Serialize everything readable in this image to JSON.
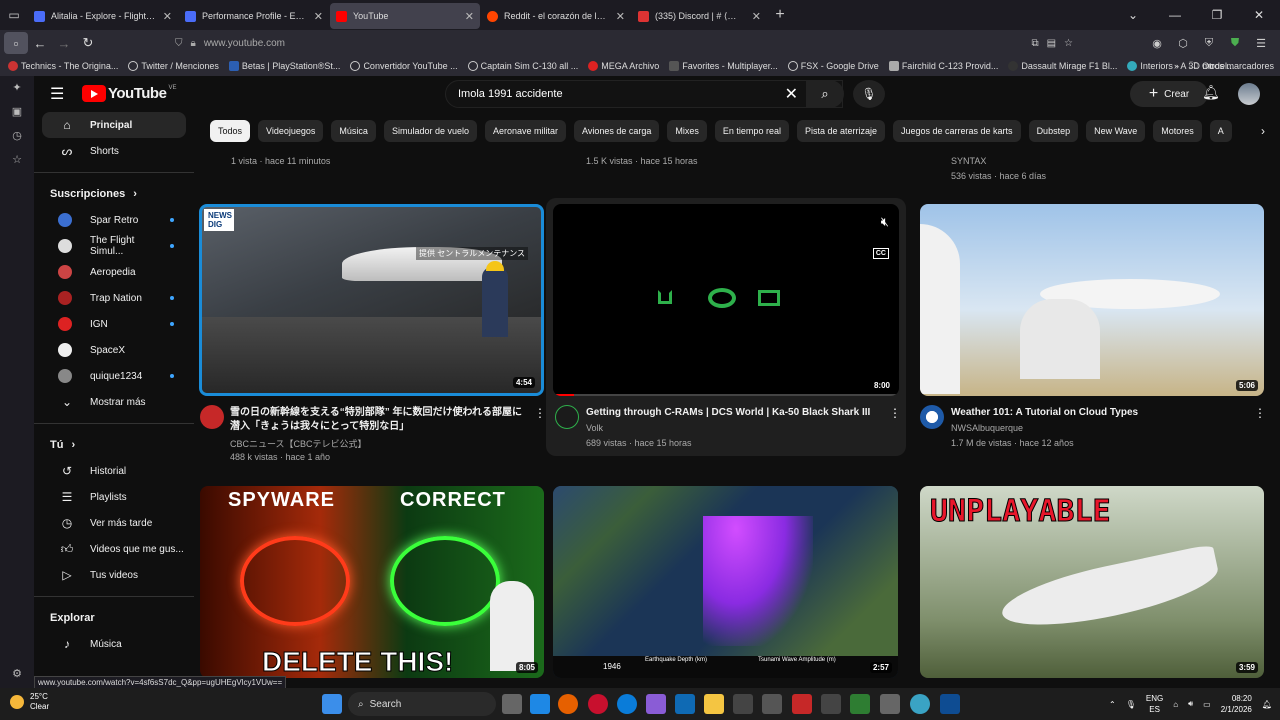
{
  "browser": {
    "tabs": [
      {
        "title": "Alitalia - Explore - Flightsim.to",
        "color": "#4a6cf7"
      },
      {
        "title": "Performance Profile - Explore - ",
        "color": "#4a6cf7"
      },
      {
        "title": "YouTube",
        "color": "#ff0000",
        "active": true
      },
      {
        "title": "Reddit - el corazón de la conve",
        "color": "#ff4500"
      },
      {
        "title": "(335) Discord | # ⟨💬⟩ [chart",
        "color": "#d33"
      }
    ],
    "url": "www.youtube.com",
    "bookmarks": [
      "Technics - The Origina...",
      "Twitter / Menciones",
      "Betas | PlayStation®St...",
      "Convertidor YouTube ...",
      "Captain Sim C-130 all ...",
      "MEGA Archivo",
      "Favorites - Multiplayer...",
      "FSX - Google Drive",
      "Fairchild C-123 Provid...",
      "Dassault Mirage F1 Bl...",
      "Interiors - A 3D model..."
    ],
    "bookmarks_other": "Otros marcadores"
  },
  "youtube": {
    "logo": "YouTube",
    "region": "VE",
    "search_query": "Imola 1991 accidente",
    "create_label": "Crear",
    "sidebar": {
      "main": [
        {
          "label": "Principal",
          "icon": "home-icon",
          "glyph": "⌂"
        },
        {
          "label": "Shorts",
          "icon": "shorts-icon",
          "glyph": "▶"
        }
      ],
      "subs_header": "Suscripciones",
      "subs": [
        {
          "label": "Spar Retro",
          "color": "#3b6fd1"
        },
        {
          "label": "The Flight Simul...",
          "color": "#e0e0e0"
        },
        {
          "label": "Aeropedia",
          "color": "#c44"
        },
        {
          "label": "Trap Nation",
          "color": "#c22"
        },
        {
          "label": "IGN",
          "color": "#d22"
        },
        {
          "label": "SpaceX",
          "color": "#eee"
        },
        {
          "label": "quique1234",
          "color": "#888"
        }
      ],
      "show_more": "Mostrar más",
      "you_header": "Tú",
      "you": [
        {
          "label": "Historial",
          "glyph": "↺"
        },
        {
          "label": "Playlists",
          "glyph": "☰"
        },
        {
          "label": "Ver más tarde",
          "glyph": "◷"
        },
        {
          "label": "Videos que me gus...",
          "glyph": "👍"
        },
        {
          "label": "Tus videos",
          "glyph": "▷"
        }
      ],
      "explore_header": "Explorar",
      "explore": [
        {
          "label": "Música",
          "glyph": "♪"
        }
      ]
    },
    "chips": [
      "Todos",
      "Videojuegos",
      "Música",
      "Simulador de vuelo",
      "Aeronave militar",
      "Aviones de carga",
      "Mixes",
      "En tiempo real",
      "Pista de aterrizaje",
      "Juegos de carreras de karts",
      "Dubstep",
      "New Wave",
      "Motores",
      "A"
    ],
    "top_meta": [
      "1 vista · hace 11 minutos",
      "1.5 K vistas · hace 15 horas",
      "SYNTAX",
      "536 vistas · hace 6 días"
    ],
    "videos": [
      {
        "title": "雪の日の新幹線を支える“特別部隊” 年に数回だけ使われる部屋に潜入「きょうは我々にとって特別な日」",
        "channel": "CBCニュース【CBCテレビ公式】",
        "meta": "488 k vistas · hace 1 año",
        "duration": "4:54",
        "badge": "NEWS DIG",
        "caption": "提供 セントラルメンテナンス"
      },
      {
        "title": "Getting through C-RAMs | DCS World | Ka-50 Black Shark III",
        "channel": "Volk",
        "meta": "689 vistas · hace 15 horas",
        "duration": "8:00",
        "cc": "CC"
      },
      {
        "title": "Weather 101: A Tutorial on Cloud Types",
        "channel": "NWSAlbuquerque",
        "meta": "1.7 M de vistas · hace 12 años",
        "duration": "5:06"
      },
      {
        "duration": "8:05",
        "overlay_top_left": "SPYWARE",
        "overlay_top_right": "CORRECT",
        "overlay_bottom": "DELETE THIS!"
      },
      {
        "duration": "2:57",
        "legend_year": "1946",
        "legend1": "Earthquake Depth (km)",
        "legend2": "Tsunami Wave Amplitude (m)"
      },
      {
        "duration": "3:59",
        "overlay_top": "UNPLAYABLE"
      }
    ],
    "status_url": "www.youtube.com/watch?v=4sf6sS7dc_Q&pp=ugUHEgVlcy1VUw=="
  },
  "taskbar": {
    "temp": "25°C",
    "weather": "Clear",
    "search_placeholder": "Search",
    "lang1": "ENG",
    "lang2": "ES",
    "time": "08:20",
    "date": "2/1/2026"
  }
}
